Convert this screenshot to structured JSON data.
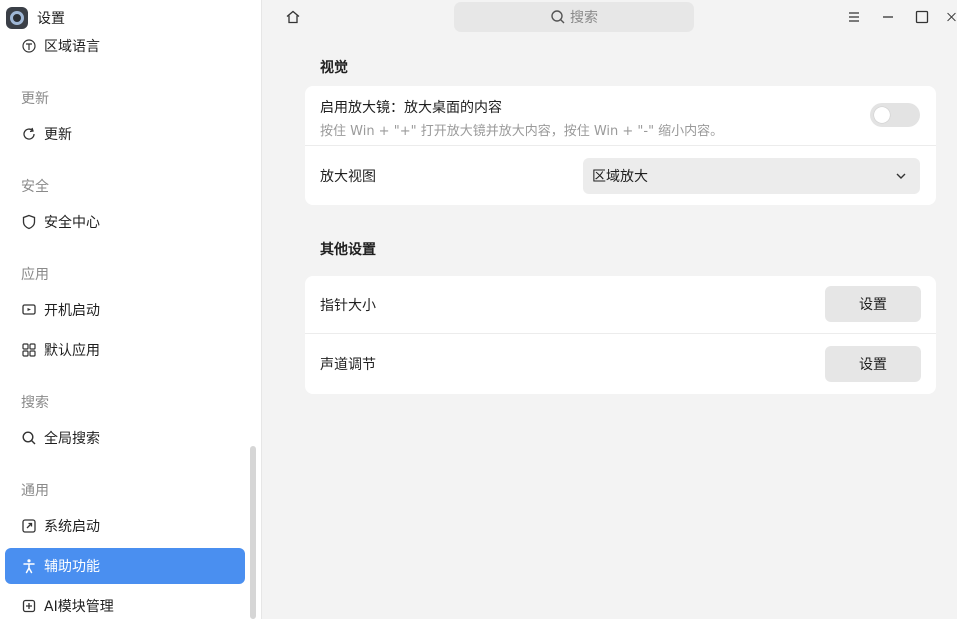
{
  "app": {
    "title": "设置"
  },
  "sidebar": {
    "items": [
      {
        "label": "区域语言",
        "icon": "region-language-icon"
      },
      {
        "header": "更新"
      },
      {
        "label": "更新",
        "icon": "refresh-icon"
      },
      {
        "header": "安全"
      },
      {
        "label": "安全中心",
        "icon": "shield-icon"
      },
      {
        "header": "应用"
      },
      {
        "label": "开机启动",
        "icon": "startup-icon"
      },
      {
        "label": "默认应用",
        "icon": "grid-icon"
      },
      {
        "header": "搜索"
      },
      {
        "label": "全局搜索",
        "icon": "search-icon"
      },
      {
        "header": "通用"
      },
      {
        "label": "系统启动",
        "icon": "boot-icon"
      },
      {
        "label": "辅助功能",
        "icon": "accessibility-icon",
        "active": true
      },
      {
        "label": "AI模块管理",
        "icon": "ai-module-icon"
      }
    ]
  },
  "topbar": {
    "search_placeholder": "搜索"
  },
  "sections": {
    "visual": {
      "title": "视觉",
      "magnifier_label": "启用放大镜：放大桌面的内容",
      "magnifier_hint": "按住 Win + \"+\" 打开放大镜并放大内容，按住 Win + \"-\" 缩小内容。",
      "magnifier_enabled": false,
      "zoom_view_label": "放大视图",
      "zoom_view_value": "区域放大"
    },
    "other": {
      "title": "其他设置",
      "pointer_size_label": "指针大小",
      "pointer_size_button": "设置",
      "channel_label": "声道调节",
      "channel_button": "设置"
    }
  },
  "colors": {
    "accent": "#4a8ff0"
  }
}
